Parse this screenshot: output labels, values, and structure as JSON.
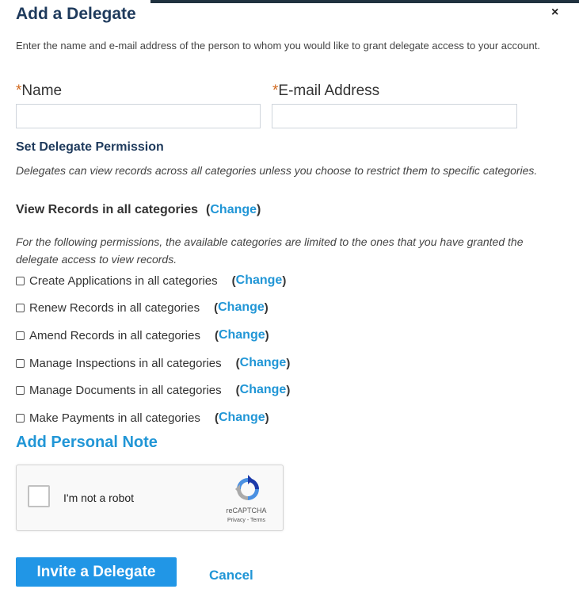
{
  "dialog": {
    "title": "Add a Delegate",
    "close_glyph": "×",
    "intro": "Enter the name and e-mail address of the person to whom you would like to grant delegate access to your account."
  },
  "fields": {
    "required_marker": "*",
    "name_label": "Name",
    "name_value": "",
    "email_label": "E-mail Address",
    "email_value": ""
  },
  "permissions": {
    "section_title": "Set Delegate Permission",
    "view_note": "Delegates can view records across all categories unless you choose to restrict them to specific categories.",
    "view_records_label": "View Records in all categories",
    "limit_note": "For the following permissions, the available categories are limited to the ones that you have granted the delegate access to view records.",
    "change_label": "Change",
    "paren_open": "(",
    "paren_close": ")",
    "items": [
      {
        "label": "Create Applications in all categories",
        "checked": false
      },
      {
        "label": "Renew Records in all categories",
        "checked": false
      },
      {
        "label": "Amend Records in all categories",
        "checked": false
      },
      {
        "label": "Manage Inspections in all categories",
        "checked": false
      },
      {
        "label": "Manage Documents in all categories",
        "checked": false
      },
      {
        "label": "Make Payments in all categories",
        "checked": false
      }
    ]
  },
  "note": {
    "add_label": "Add Personal Note"
  },
  "captcha": {
    "label": "I'm not a robot",
    "brand": "reCAPTCHA",
    "links": "Privacy - Terms",
    "checked": false
  },
  "actions": {
    "invite_label": "Invite a Delegate",
    "cancel_label": "Cancel"
  },
  "colors": {
    "title": "#1e3a5c",
    "accent": "#2196d6",
    "button": "#2196e6",
    "required": "#d2691e"
  }
}
